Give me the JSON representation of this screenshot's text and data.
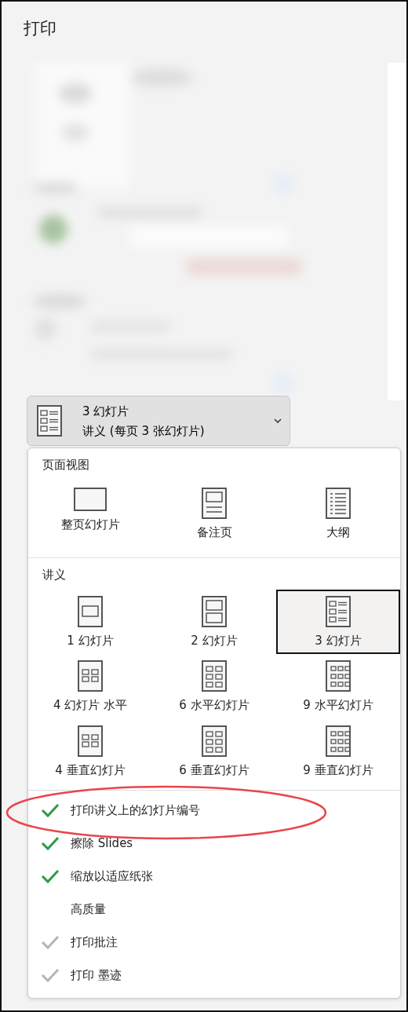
{
  "title": "打印",
  "dropdown": {
    "title": "3 幻灯片",
    "subtitle": "讲义 (每页 3 张幻灯片)"
  },
  "sections": [
    {
      "heading": "页面视图",
      "items": [
        {
          "label": "整页幻灯片",
          "selected": false
        },
        {
          "label": "备注页",
          "selected": false
        },
        {
          "label": "大纲",
          "selected": false
        }
      ]
    },
    {
      "heading": "讲义",
      "items": [
        {
          "label": "1 幻灯片",
          "selected": false
        },
        {
          "label": "2 幻灯片",
          "selected": false
        },
        {
          "label": "3 幻灯片",
          "selected": true
        },
        {
          "label": "4 幻灯片 水平",
          "selected": false
        },
        {
          "label": "6 水平幻灯片",
          "selected": false
        },
        {
          "label": "9 水平幻灯片",
          "selected": false
        },
        {
          "label": "4 垂直幻灯片",
          "selected": false
        },
        {
          "label": "6 垂直幻灯片",
          "selected": false
        },
        {
          "label": "9 垂直幻灯片",
          "selected": false
        }
      ]
    }
  ],
  "options": [
    {
      "label": "打印讲义上的幻灯片编号",
      "checked": true,
      "disabled": false,
      "highlighted": true
    },
    {
      "label": "擦除 Slides",
      "checked": true,
      "disabled": false,
      "highlighted": false
    },
    {
      "label": "缩放以适应纸张",
      "checked": true,
      "disabled": false,
      "highlighted": false
    },
    {
      "label": "高质量",
      "checked": false,
      "highlighted": false
    },
    {
      "label": "打印批注",
      "checked": true,
      "disabled": true,
      "highlighted": false
    },
    {
      "label": "打印 墨迹",
      "checked": true,
      "disabled": true,
      "highlighted": false
    }
  ]
}
